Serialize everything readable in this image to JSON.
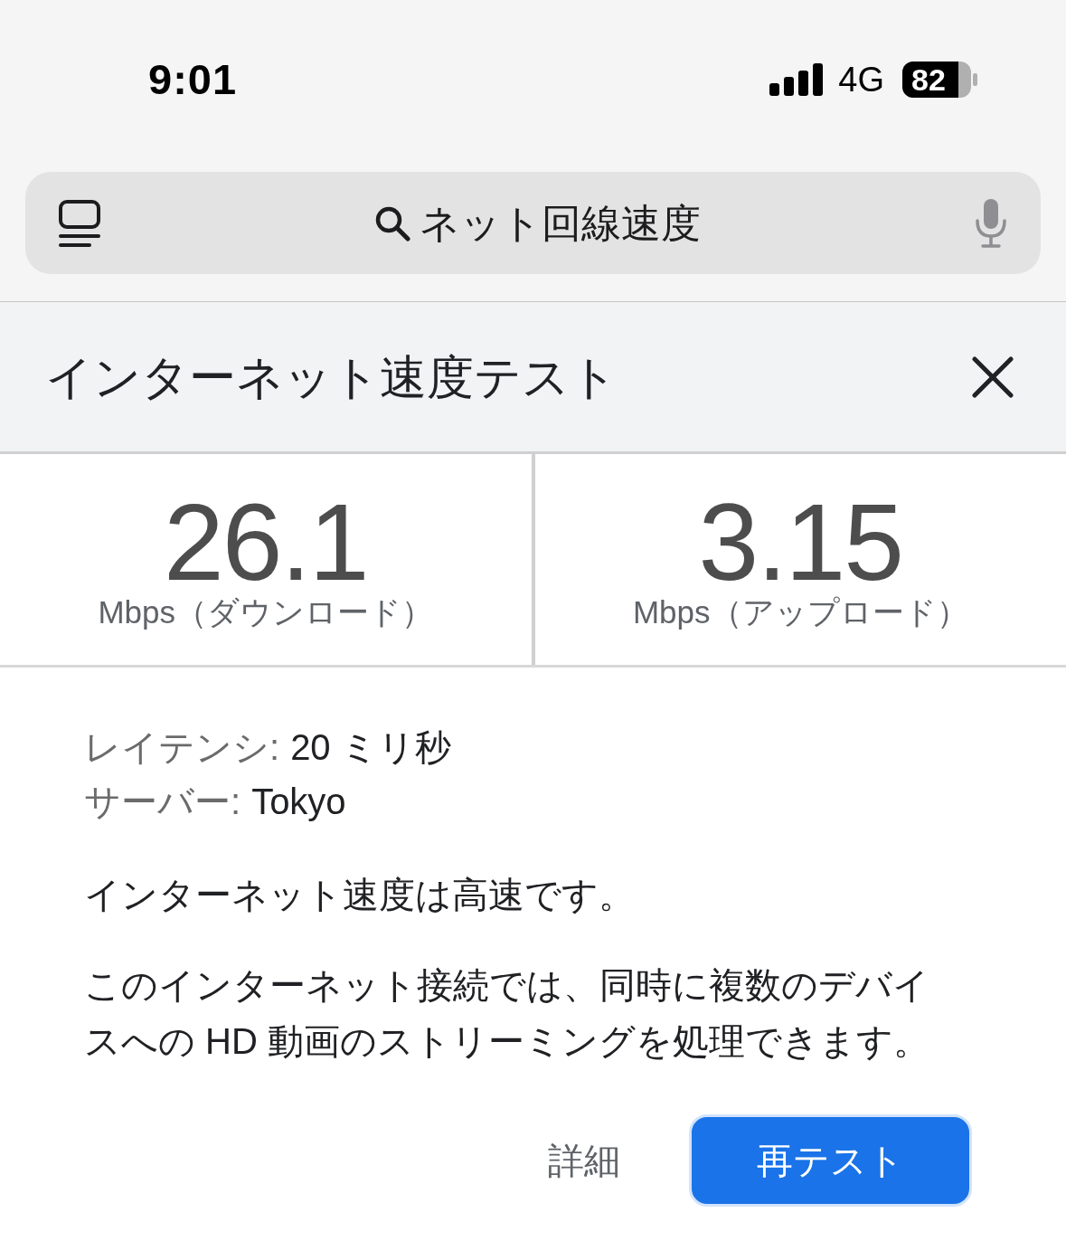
{
  "status_bar": {
    "time": "9:01",
    "network": "4G",
    "battery": "82"
  },
  "search_bar": {
    "query": "ネット回線速度"
  },
  "card": {
    "title": "インターネット速度テスト",
    "results": [
      {
        "value": "26.1",
        "label": "Mbps（ダウンロード）"
      },
      {
        "value": "3.15",
        "label": "Mbps（アップロード）"
      }
    ],
    "details": [
      {
        "label": "レイテンシ:",
        "value": "20 ミリ秒"
      },
      {
        "label": "サーバー:",
        "value": "Tokyo"
      }
    ],
    "summary": "インターネット速度は高速です。",
    "description": "このインターネット接続では、同時に複数のデバイスへの HD 動画のストリーミングを処理できます。",
    "buttons": [
      {
        "label": "詳細",
        "kind": "text"
      },
      {
        "label": "再テスト",
        "kind": "filled"
      }
    ]
  }
}
